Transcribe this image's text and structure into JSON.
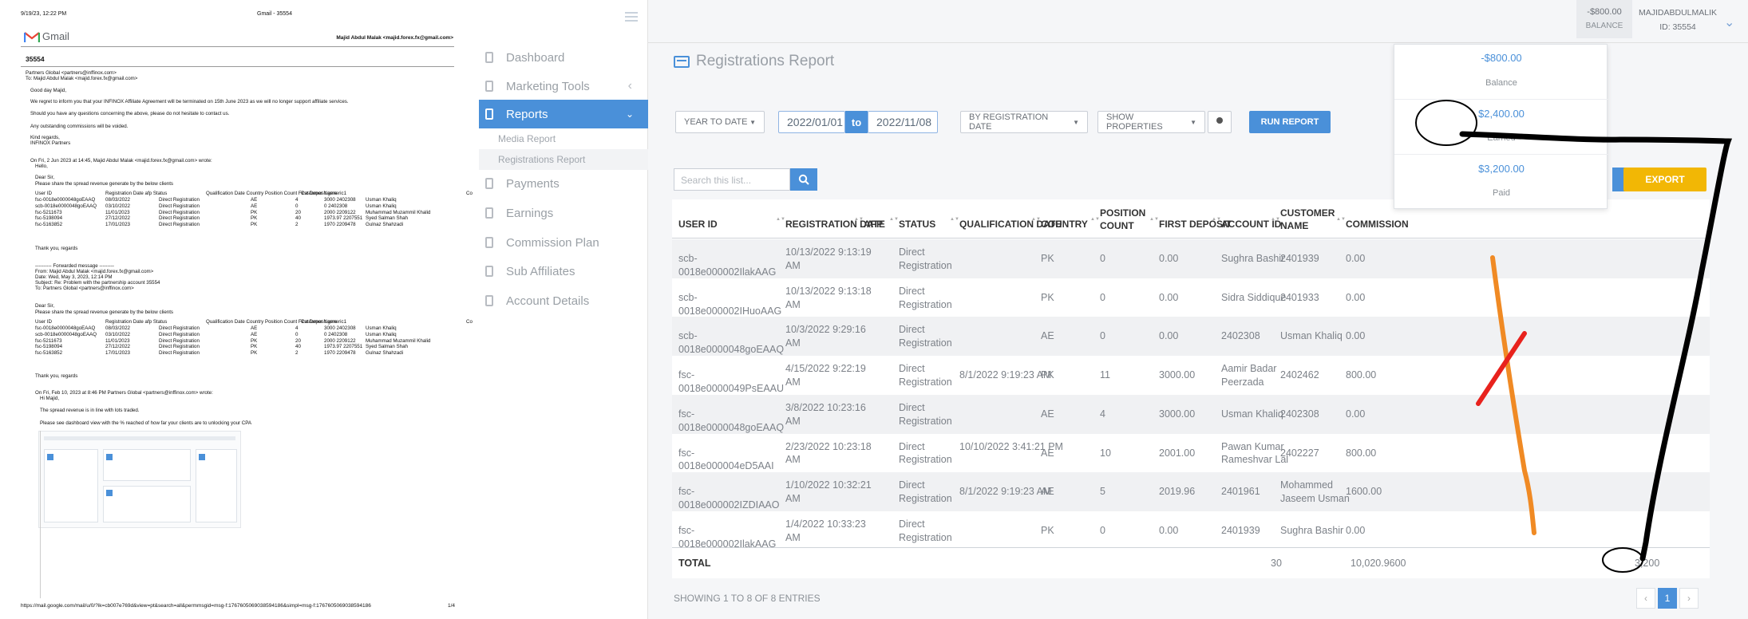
{
  "pdf_print": {
    "header_left": "9/19/23, 12:22 PM",
    "header_center": "Gmail - 35554",
    "gmail_label": "Gmail",
    "account": "Majid Abdul Malak <majid.forex.fx@gmail.com>",
    "subject": "35554",
    "from_line": "Partners Global <partners@inffinox.com>",
    "to_line": "To: Majid Abdul Malak <majid.forex.fx@gmail.com>",
    "body": [
      "Good day Majid,",
      "We regret to inform you that your INFINOX Affiliate Agreement will be terminated on 15th June 2023 as we will no longer support affiliate services.",
      "Should you have any questions concerning the above, please do not hesitate to contact us.",
      "Any outstanding commissions will be voided.",
      "Kind regards,",
      "INFINOX Partners"
    ],
    "quote1_intro": "On Fri, 2 Jun 2023 at 14:45, Majid Abdul Malak <majid.forex.fx@gmail.com> wrote:",
    "quote1_lines": [
      "Hello,",
      "Dear Sir,",
      "Please share the spread revenue generate by the below clients"
    ],
    "table_header": [
      "User ID",
      "Registration Date afp Status",
      "Qualification Date Country Position Count First Deposit generic1",
      "Customer Name",
      "Co"
    ],
    "table_rows": [
      [
        "fsc-0018e0000048goEAAQ",
        "08/03/2022",
        "Direct Registration",
        "AE",
        "4",
        "3000 2402308",
        "Usman Khaliq"
      ],
      [
        "scb-0018e0000048goEAAQ",
        "03/10/2022",
        "Direct Registration",
        "AE",
        "0",
        "0 2402308",
        "Usman Khaliq"
      ],
      [
        "fsc-5211673",
        "11/01/2023",
        "Direct Registration",
        "PK",
        "20",
        "2000 2209122",
        "Muhammad Muzammil Khalid"
      ],
      [
        "fsc-5198094",
        "27/12/2022",
        "Direct Registration",
        "PK",
        "40",
        "1973.97 2207551",
        "Syed Salman Shah"
      ],
      [
        "fsc-5163852",
        "17/01/2023",
        "Direct Registration",
        "PK",
        "2",
        "1970 2209478",
        "Gulnaz Shahzadi"
      ]
    ],
    "thanks": "Thank you, regards",
    "forward_block": [
      "---------- Forwarded message ---------",
      "From: Majid Abdul Malak <majid.forex.fx@gmail.com>",
      "Date: Wed, May 3, 2023, 12:14 PM",
      "Subject: Re: Problem with the partnership account 35554",
      "To: Partners Global <partners@inffinox.com>"
    ],
    "quote2_intro": "On Fri, Feb 10, 2023 at 8:46 PM Partners Global <partners@inffinox.com> wrote:",
    "quote2_lines": [
      "Hi Majid,",
      "The spread revenue is in line with lots traded.",
      "Please see dashboard view with the % reached of how far your clients are to unlocking your CPA"
    ],
    "footer_url": "https://mail.google.com/mail/u/0/?ik=cb007e769d&view=pt&search=all&permmsgid=msg-f:1767605069038594186&simpl=msg-f:1767605069038594186",
    "footer_page": "1/4"
  },
  "sidebar": {
    "items": [
      {
        "label": "Dashboard",
        "active": false
      },
      {
        "label": "Marketing Tools",
        "active": false
      },
      {
        "label": "Reports",
        "active": true
      },
      {
        "label": "Payments",
        "active": false
      },
      {
        "label": "Earnings",
        "active": false
      },
      {
        "label": "Commission Plan",
        "active": false
      },
      {
        "label": "Sub Affiliates",
        "active": false
      },
      {
        "label": "Account Details",
        "active": false
      }
    ],
    "subitems": [
      "Media Report",
      "Registrations Report"
    ]
  },
  "topbar": {
    "balance_value": "-$800.00",
    "balance_label": "BALANCE",
    "user_name": "MAJIDABDULMALIK",
    "user_id": "ID: 35554"
  },
  "balance_dropdown": {
    "items": [
      {
        "value": "-$800.00",
        "label": "Balance"
      },
      {
        "value": "$2,400.00",
        "label": "Earned"
      },
      {
        "value": "$3,200.00",
        "label": "Paid"
      }
    ]
  },
  "report": {
    "title": "Registrations Report",
    "filters": {
      "period": "YEAR TO DATE",
      "date_from": "2022/01/01",
      "to_label": "to",
      "date_to": "2022/11/08",
      "by": "BY REGISTRATION DATE",
      "properties": "SHOW PROPERTIES",
      "run": "RUN REPORT"
    },
    "search_placeholder": "Search this list...",
    "export": "EXPORT",
    "columns": [
      "USER ID",
      "REGISTRATION DATE",
      "AFP",
      "STATUS",
      "QUALIFICATION DATE",
      "COUNTRY",
      "POSITION COUNT",
      "FIRST DEPOSIT",
      "ACCOUNT ID",
      "CUSTOMER NAME",
      "COMMISSION"
    ],
    "rows": [
      {
        "user_id": "scb-0018e000002IlakAAG",
        "reg_date": "10/13/2022 9:13:19 AM",
        "afp": "",
        "status": "Direct Registration",
        "qual_date": "",
        "country": "PK",
        "pos": "0",
        "deposit": "0.00",
        "account": "Sughra Bashir",
        "customer": "2401939",
        "commission": "0.00"
      },
      {
        "user_id": "scb-0018e000002IHuoAAG",
        "reg_date": "10/13/2022 9:13:18 AM",
        "afp": "",
        "status": "Direct Registration",
        "qual_date": "",
        "country": "PK",
        "pos": "0",
        "deposit": "0.00",
        "account": "Sidra Siddique",
        "customer": "2401933",
        "commission": "0.00"
      },
      {
        "user_id": "scb-0018e0000048goEAAQ",
        "reg_date": "10/3/2022 9:29:16 AM",
        "afp": "",
        "status": "Direct Registration",
        "qual_date": "",
        "country": "AE",
        "pos": "0",
        "deposit": "0.00",
        "account": "2402308",
        "customer": "Usman Khaliq",
        "commission": "0.00"
      },
      {
        "user_id": "fsc-0018e0000049PsEAAU",
        "reg_date": "4/15/2022 9:22:19 AM",
        "afp": "",
        "status": "Direct Registration",
        "qual_date": "8/1/2022 9:19:23 AM",
        "country": "PK",
        "pos": "11",
        "deposit": "3000.00",
        "account": "Aamir Badar Peerzada",
        "customer": "2402462",
        "commission": "800.00"
      },
      {
        "user_id": "fsc-0018e0000048goEAAQ",
        "reg_date": "3/8/2022 10:23:16 AM",
        "afp": "",
        "status": "Direct Registration",
        "qual_date": "",
        "country": "AE",
        "pos": "4",
        "deposit": "3000.00",
        "account": "Usman Khaliq",
        "customer": "2402308",
        "commission": "0.00"
      },
      {
        "user_id": "fsc-0018e000004eD5AAI",
        "reg_date": "2/23/2022 10:23:18 AM",
        "afp": "",
        "status": "Direct Registration",
        "qual_date": "10/10/2022 3:41:21 PM",
        "country": "AE",
        "pos": "10",
        "deposit": "2001.00",
        "account": "Pawan Kumar Rameshvar Lal",
        "customer": "2402227",
        "commission": "800.00"
      },
      {
        "user_id": "fsc-0018e000002IZDIAAO",
        "reg_date": "1/10/2022 10:32:21 AM",
        "afp": "",
        "status": "Direct Registration",
        "qual_date": "8/1/2022 9:19:23 AM",
        "country": "AE",
        "pos": "5",
        "deposit": "2019.96",
        "account": "2401961",
        "customer": "Mohammed Jaseem Usman",
        "commission": "1600.00"
      },
      {
        "user_id": "fsc-0018e000002IlakAAG",
        "reg_date": "1/4/2022 10:33:23 AM",
        "afp": "",
        "status": "Direct Registration",
        "qual_date": "",
        "country": "PK",
        "pos": "0",
        "deposit": "0.00",
        "account": "2401939",
        "customer": "Sughra Bashir",
        "commission": "0.00"
      }
    ],
    "total": {
      "label": "TOTAL",
      "pos": "30",
      "deposit": "10,020.9600",
      "commission": "3,200"
    },
    "showing": "SHOWING 1 TO 8 OF 8 ENTRIES",
    "page": "1"
  },
  "colors": {
    "accent": "#4a90d9",
    "active_nav": "#4a90d9",
    "run_button": "#4a90d9",
    "export": "#f2b705",
    "annotation_black": "#000000",
    "annotation_orange": "#f08a24",
    "annotation_red": "#e8221d"
  }
}
